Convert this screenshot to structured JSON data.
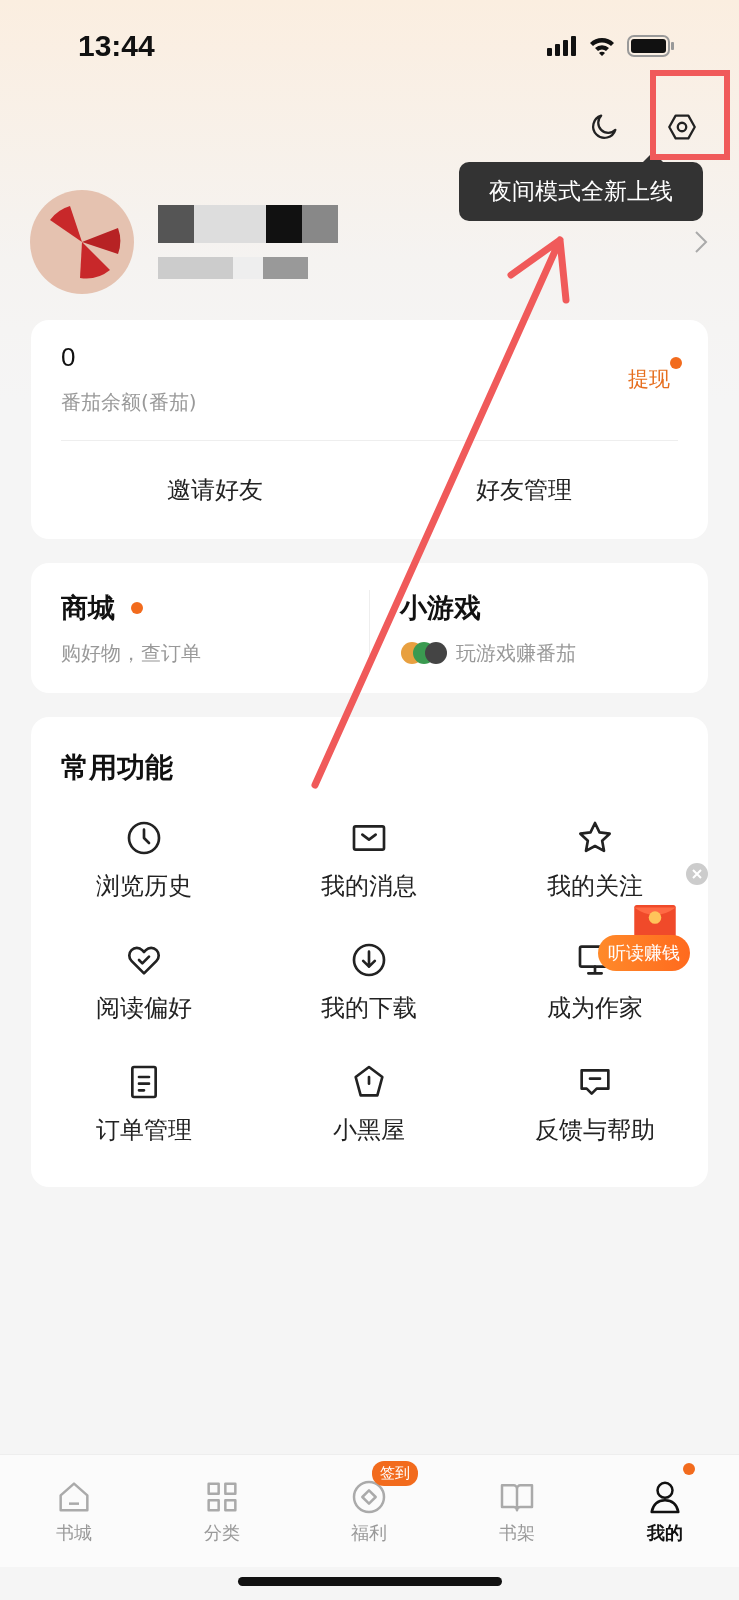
{
  "status_bar": {
    "time": "13:44"
  },
  "tooltip": {
    "text": "夜间模式全新上线"
  },
  "wallet": {
    "balance": "0",
    "balance_label": "番茄余额(番茄)",
    "withdraw": "提现",
    "withdraw_dot": true,
    "actions": [
      "邀请好友",
      "好友管理"
    ]
  },
  "shortcuts": [
    {
      "title": "商城",
      "subtitle": "购好物，查订单",
      "dot": true
    },
    {
      "title": "小游戏",
      "subtitle": "玩游戏赚番茄",
      "dot": false
    }
  ],
  "functions": {
    "title": "常用功能",
    "items": [
      {
        "label": "浏览历史",
        "kind": "clock"
      },
      {
        "label": "我的消息",
        "kind": "mail"
      },
      {
        "label": "我的关注",
        "kind": "star"
      },
      {
        "label": "阅读偏好",
        "kind": "heart"
      },
      {
        "label": "我的下载",
        "kind": "download"
      },
      {
        "label": "成为作家",
        "kind": "monitor"
      },
      {
        "label": "订单管理",
        "kind": "doc"
      },
      {
        "label": "小黑屋",
        "kind": "house"
      },
      {
        "label": "反馈与帮助",
        "kind": "chat"
      }
    ]
  },
  "floating_badge": {
    "text": "听读赚钱"
  },
  "tabs": [
    {
      "label": "书城",
      "kind": "home",
      "selected": false,
      "dot": false
    },
    {
      "label": "分类",
      "kind": "grid",
      "selected": false,
      "dot": false
    },
    {
      "label": "福利",
      "kind": "coin",
      "selected": false,
      "dot": false,
      "badge": "签到"
    },
    {
      "label": "书架",
      "kind": "book",
      "selected": false,
      "dot": false
    },
    {
      "label": "我的",
      "kind": "user",
      "selected": true,
      "dot": true
    }
  ]
}
